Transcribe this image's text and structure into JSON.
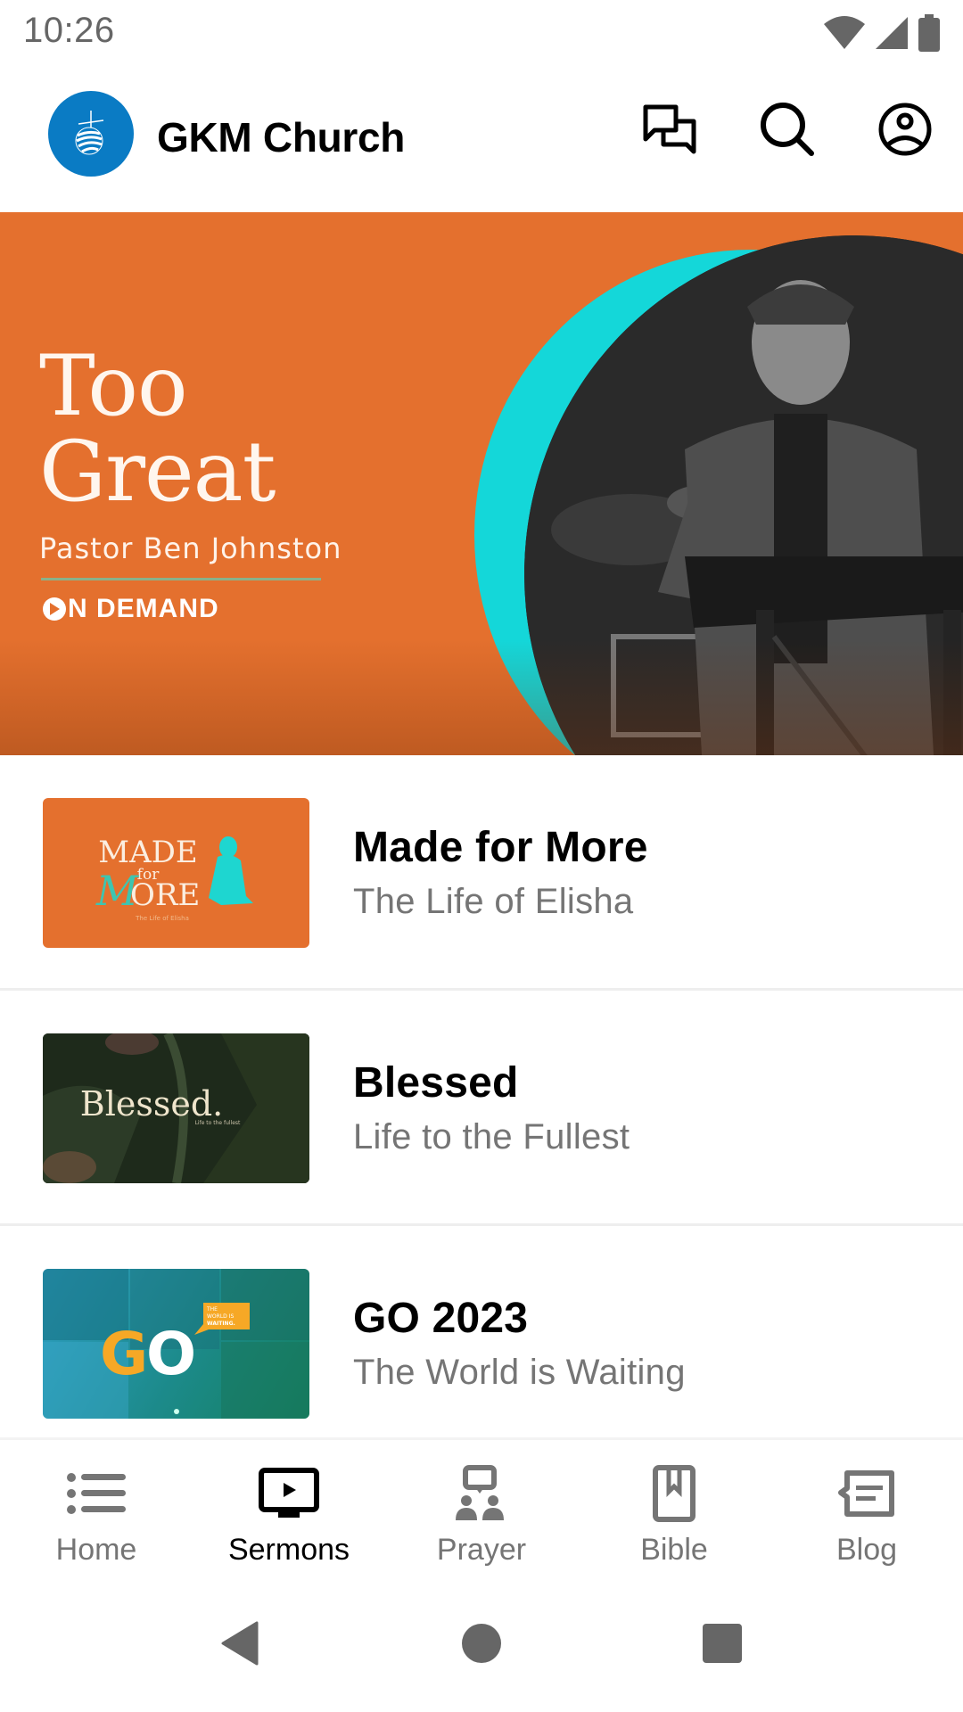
{
  "status_bar": {
    "time": "10:26",
    "icons": [
      "wifi-icon",
      "signal-icon",
      "battery-icon"
    ]
  },
  "app_bar": {
    "title": "GKM Church",
    "logo": "gkm-globe-logo",
    "actions": [
      {
        "name": "chat",
        "icon": "chat-bubbles-icon"
      },
      {
        "name": "search",
        "icon": "search-icon"
      },
      {
        "name": "account",
        "icon": "account-circle-icon"
      }
    ]
  },
  "hero": {
    "title_line1": "Too",
    "title_line2": "Great",
    "speaker": "Pastor Ben Johnston",
    "badge": "N DEMAND",
    "badge_full": "ON DEMAND",
    "colors": {
      "background": "#e4702e",
      "accent": "#14d7d9"
    }
  },
  "sermons": [
    {
      "title": "Made for More",
      "subtitle": "The Life of Elisha",
      "thumb_text": "MADE for MORE",
      "thumb_caption": "The Life of Elisha"
    },
    {
      "title": "Blessed",
      "subtitle": "Life to the Fullest",
      "thumb_text": "Blessed.",
      "thumb_caption": "Life to the fullest"
    },
    {
      "title": "GO 2023",
      "subtitle": "The World is Waiting",
      "thumb_text": "GO",
      "thumb_caption": "THE WORLD IS WAITING."
    }
  ],
  "bottom_nav": {
    "active": "Sermons",
    "items": [
      {
        "label": "Home",
        "icon": "list-icon"
      },
      {
        "label": "Sermons",
        "icon": "tv-play-icon"
      },
      {
        "label": "Prayer",
        "icon": "prayer-group-icon"
      },
      {
        "label": "Bible",
        "icon": "book-bookmark-icon"
      },
      {
        "label": "Blog",
        "icon": "blog-message-icon"
      }
    ]
  },
  "system_nav": [
    "back",
    "home",
    "recents"
  ]
}
